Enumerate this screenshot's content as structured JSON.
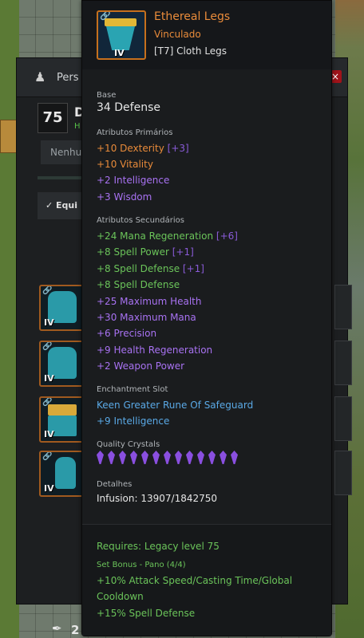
{
  "panel": {
    "title_fragment": "Pers",
    "level": "75",
    "name_fragment": "D",
    "green_fragment": "H",
    "dropdown_fragment": "Nenhu",
    "tab_fragment": "Equi",
    "feather_count": "2",
    "close_label": "×"
  },
  "tooltip": {
    "item_name": "Ethereal Legs",
    "bound": "Vinculado",
    "item_type": "[T7] Cloth Legs",
    "tier": "IV",
    "base_header": "Base",
    "base_value": "34 Defense",
    "primary_header": "Atributos Primários",
    "primary": [
      {
        "text": "+10 Dexterity",
        "bonus": "[+3]"
      },
      {
        "text": "+10 Vitality",
        "bonus": ""
      },
      {
        "text": "+2 Intelligence",
        "bonus": ""
      },
      {
        "text": "+3 Wisdom",
        "bonus": ""
      }
    ],
    "secondary_header": "Atributos Secundários",
    "secondary": [
      {
        "text": "+24 Mana Regeneration",
        "bonus": "[+6]"
      },
      {
        "text": "+8 Spell Power",
        "bonus": "[+1]"
      },
      {
        "text": "+8 Spell Defense",
        "bonus": "[+1]"
      },
      {
        "text": "+8 Spell Defense",
        "bonus": ""
      },
      {
        "text": "+25 Maximum Health",
        "bonus": ""
      },
      {
        "text": "+30 Maximum Mana",
        "bonus": ""
      },
      {
        "text": "+6 Precision",
        "bonus": ""
      },
      {
        "text": "+9 Health Regeneration",
        "bonus": ""
      },
      {
        "text": "+2 Weapon Power",
        "bonus": ""
      }
    ],
    "enchant_header": "Enchantment Slot",
    "enchant_name": "Keen Greater Rune Of Safeguard",
    "enchant_value": "+9 Intelligence",
    "crystals_header": "Quality Crystals",
    "crystal_count": 13,
    "details_header": "Detalhes",
    "infusion": "Infusion: 13907/1842750",
    "requires": "Requires: Legacy level 75",
    "set_bonus_title": "Set Bonus - Pano (4/4)",
    "set_bonus_1a": "+10% Attack Speed/Casting Time/Global",
    "set_bonus_1b": "Cooldown",
    "set_bonus_2": "+15% Spell Defense"
  },
  "colors": {
    "item_name": "#e98b3a",
    "primary_orange": "#e98b3a",
    "stat_purple": "#a872f2",
    "stat_green": "#6bc45a",
    "enchant_blue": "#5aa9e6",
    "crystal": "#8a4fe0"
  },
  "icons": [
    "character-icon",
    "close-icon",
    "link-icon",
    "feather-icon",
    "legs-armor-icon",
    "quality-crystal-icon"
  ]
}
